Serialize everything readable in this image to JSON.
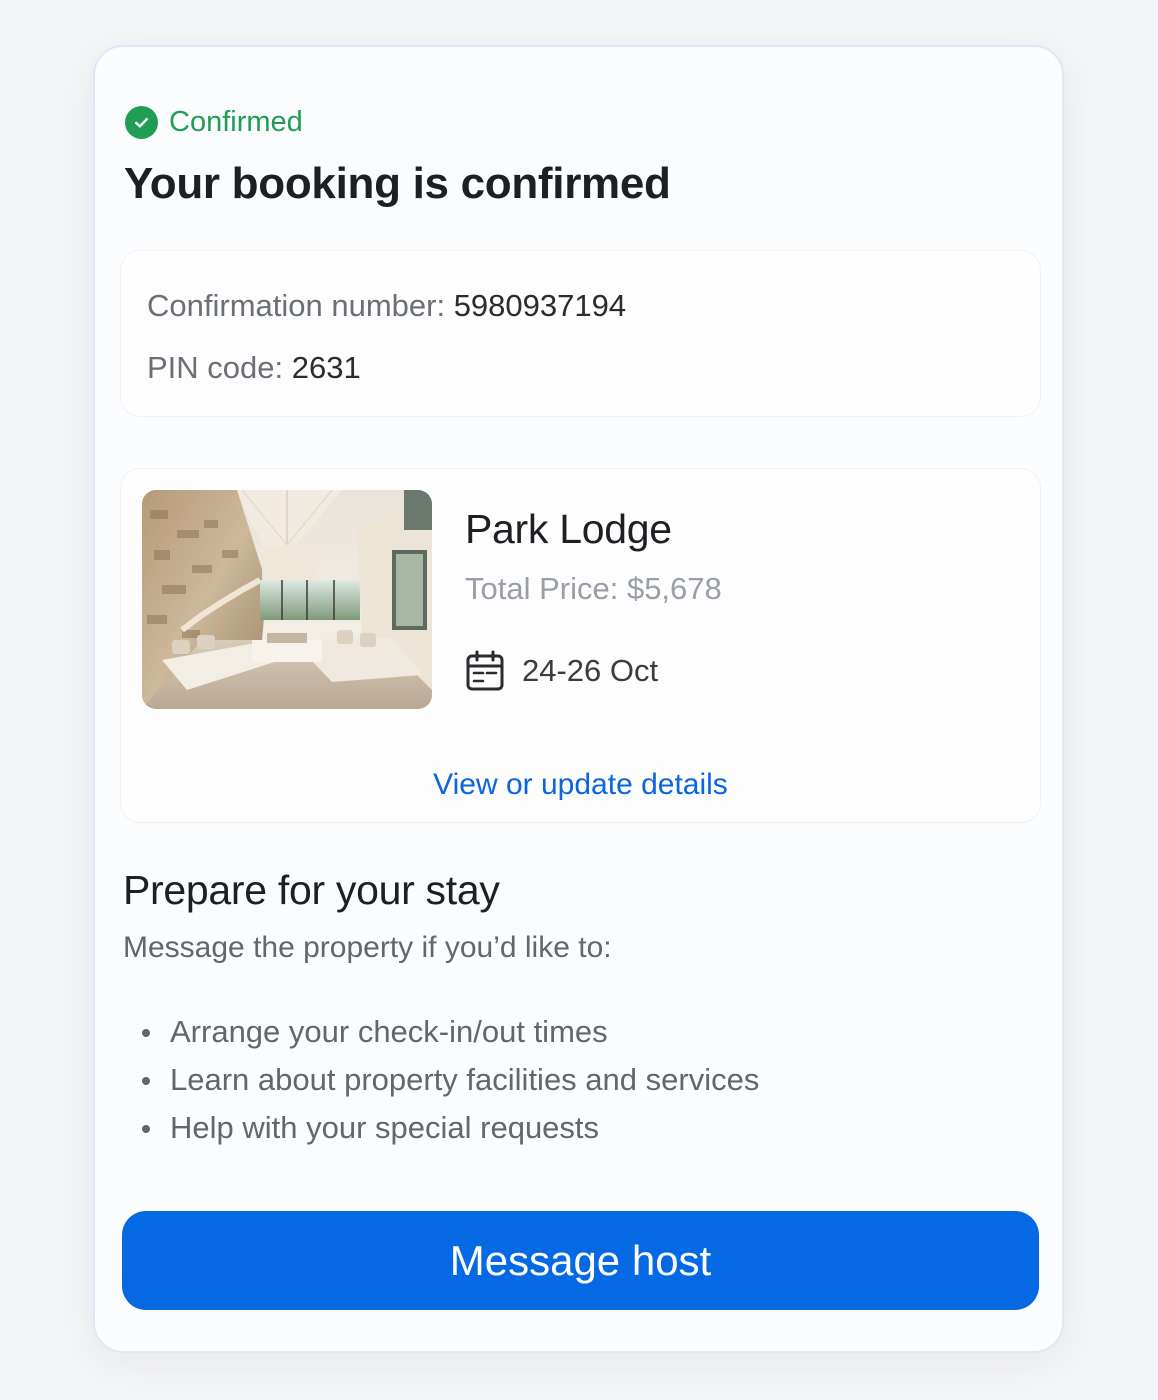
{
  "status": {
    "label": "Confirmed",
    "icon": "check-circle-icon",
    "color": "#1f9d55"
  },
  "title": "Your booking is confirmed",
  "confirmation": {
    "number_label": "Confirmation number: ",
    "number_value": "5980937194",
    "pin_label": "PIN code: ",
    "pin_value": "2631"
  },
  "property": {
    "photo_alt": "Living room with sofas and stone wall",
    "name": "Park Lodge",
    "price": "Total Price: $5,678",
    "date_icon": "calendar-icon",
    "dates": "24-26 Oct",
    "details_link": "View or update details"
  },
  "prepare": {
    "title": "Prepare for your stay",
    "subtitle": "Message the property if you’d like to:",
    "items": [
      "Arrange your check-in/out times",
      "Learn about property facilities and services",
      "Help with your special requests"
    ]
  },
  "cta": {
    "label": "Message host",
    "color": "#0469e3"
  },
  "link_color": "#0a66e0"
}
